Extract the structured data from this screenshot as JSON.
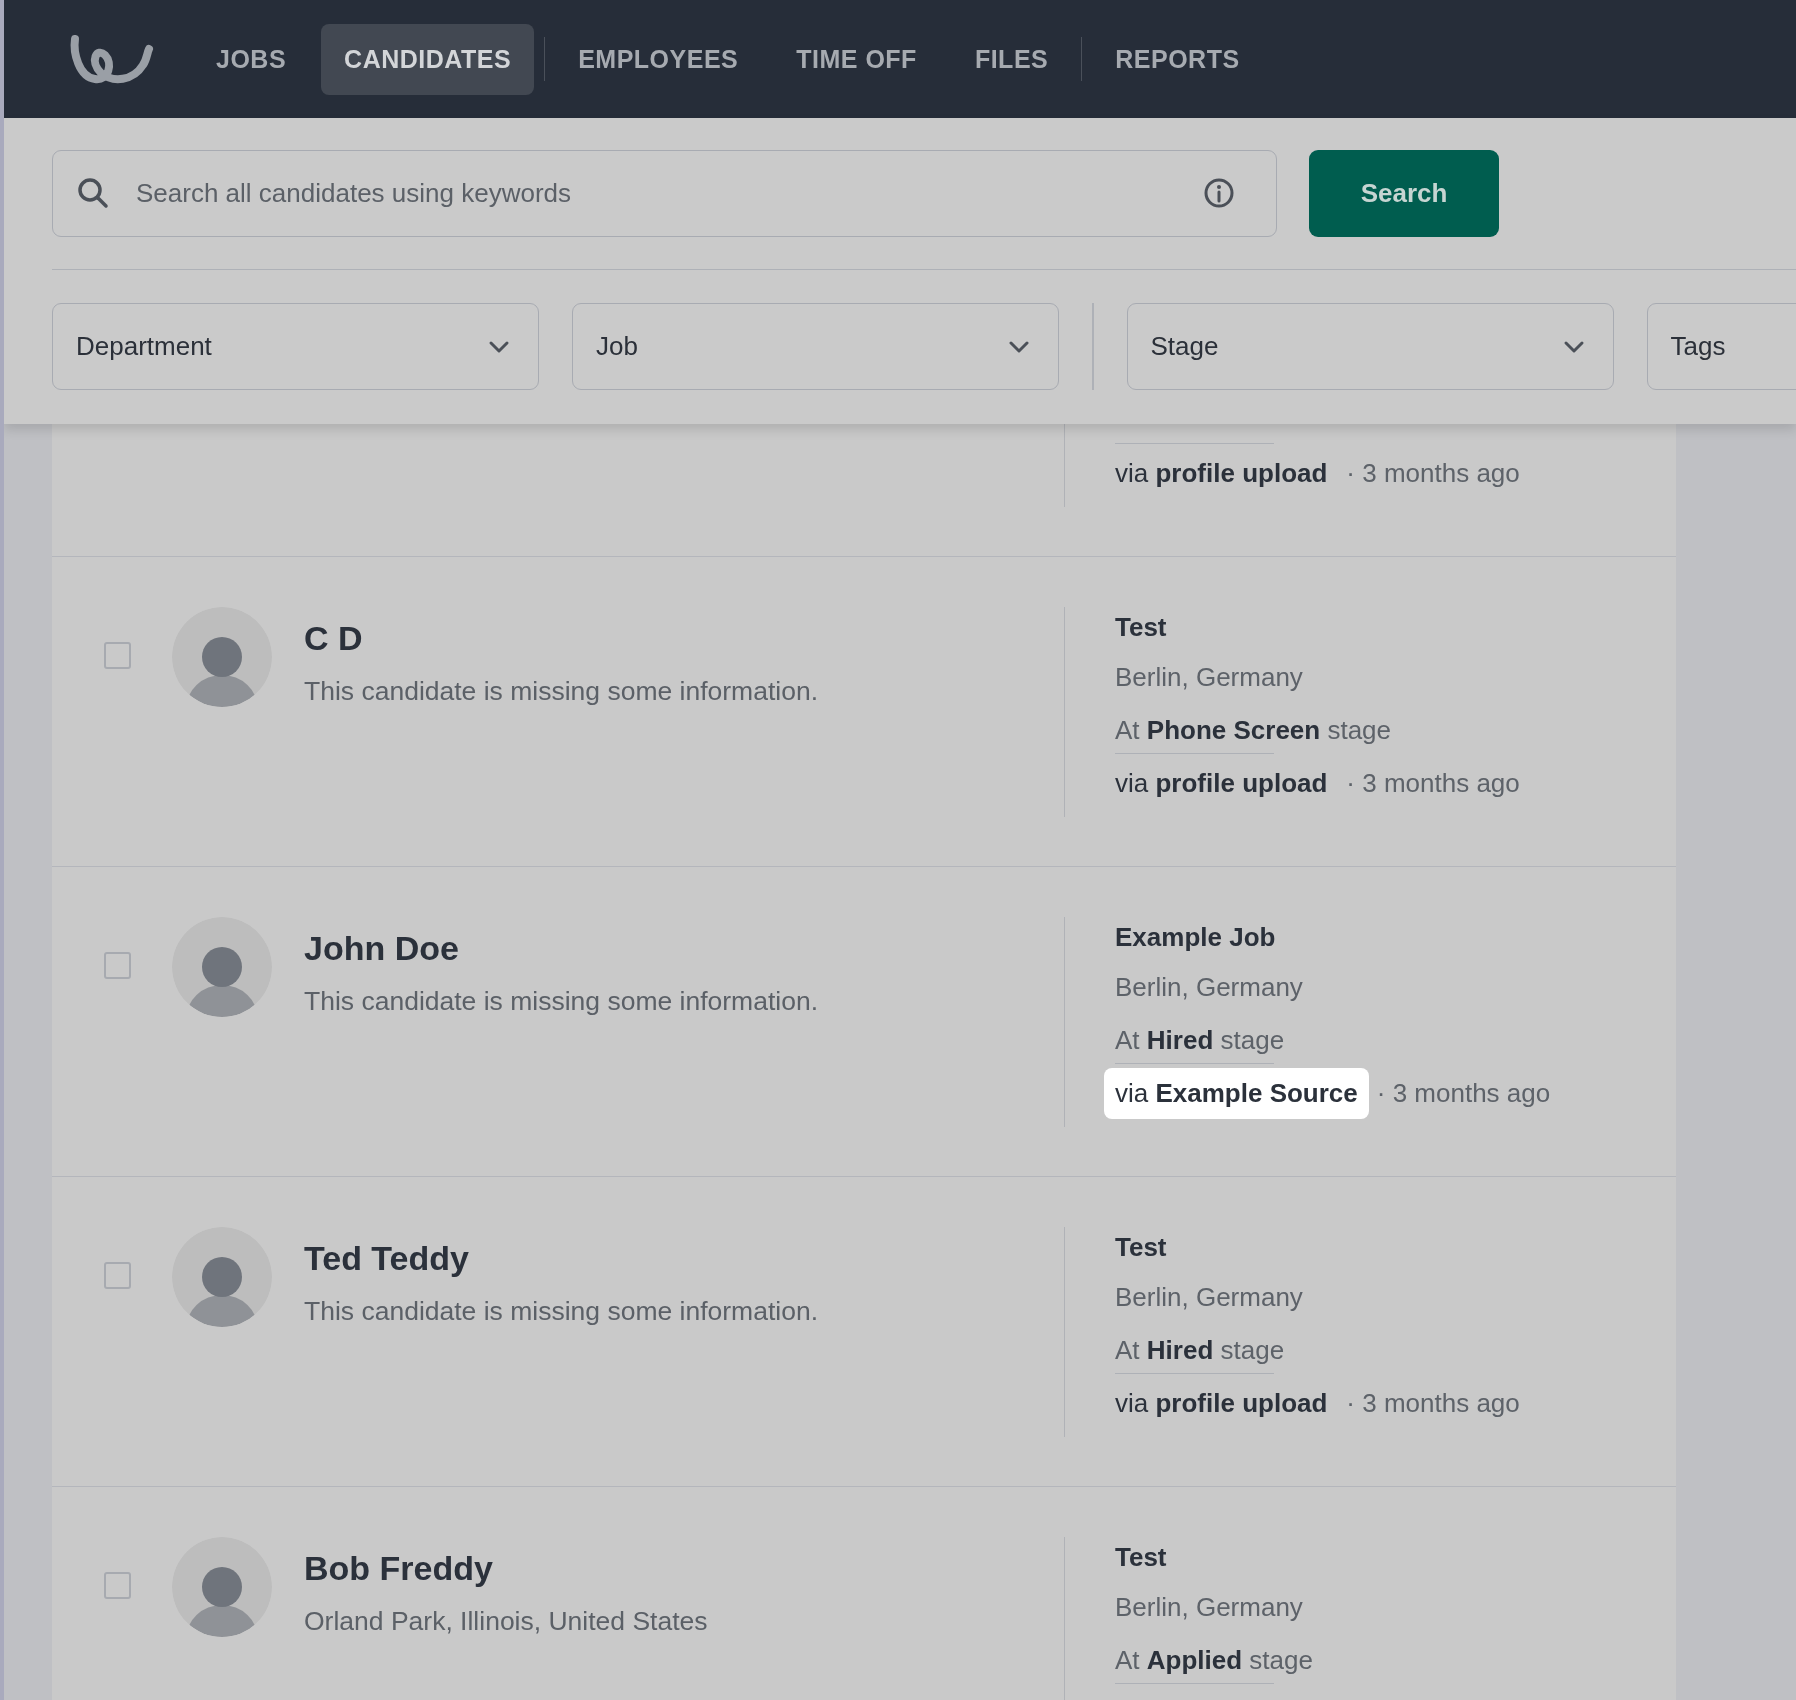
{
  "nav": {
    "tab_groups": [
      [
        {
          "label": "JOBS",
          "selected": false
        },
        {
          "label": "CANDIDATES",
          "selected": true
        }
      ],
      [
        {
          "label": "EMPLOYEES",
          "selected": false
        },
        {
          "label": "TIME OFF",
          "selected": false
        },
        {
          "label": "FILES",
          "selected": false
        }
      ],
      [
        {
          "label": "REPORTS",
          "selected": false
        }
      ]
    ]
  },
  "search": {
    "placeholder": "Search all candidates using keywords",
    "button": "Search"
  },
  "filter_groups": [
    [
      "Department",
      "Job"
    ],
    [
      "Stage",
      "Tags"
    ]
  ],
  "candidates": [
    {
      "source": "via **profile upload**",
      "time": "· 3 months ago",
      "highlighted": false
    },
    {
      "checked": false,
      "name": "C D",
      "summary": "This candidate is missing some information.",
      "job": "Test",
      "location": "Berlin, Germany",
      "stage": "At **Phone Screen** stage",
      "source": "via **profile upload**",
      "time": "· 3 months ago",
      "highlighted": false
    },
    {
      "checked": false,
      "name": "John Doe",
      "summary": "This candidate is missing some information.",
      "job": "Example Job",
      "location": "Berlin, Germany",
      "stage": "At **Hired** stage",
      "source": "via **Example Source**",
      "time": "· 3 months ago",
      "highlighted": true
    },
    {
      "checked": false,
      "name": "Ted Teddy",
      "summary": "This candidate is missing some information.",
      "job": "Test",
      "location": "Berlin, Germany",
      "stage": "At **Hired** stage",
      "source": "via **profile upload**",
      "time": "· 3 months ago",
      "highlighted": false
    },
    {
      "checked": false,
      "name": "Bob Freddy",
      "summary": "Orland Park, Illinois, United States",
      "job": "Test",
      "location": "Berlin, Germany",
      "stage": "At **Applied** stage"
    }
  ]
}
